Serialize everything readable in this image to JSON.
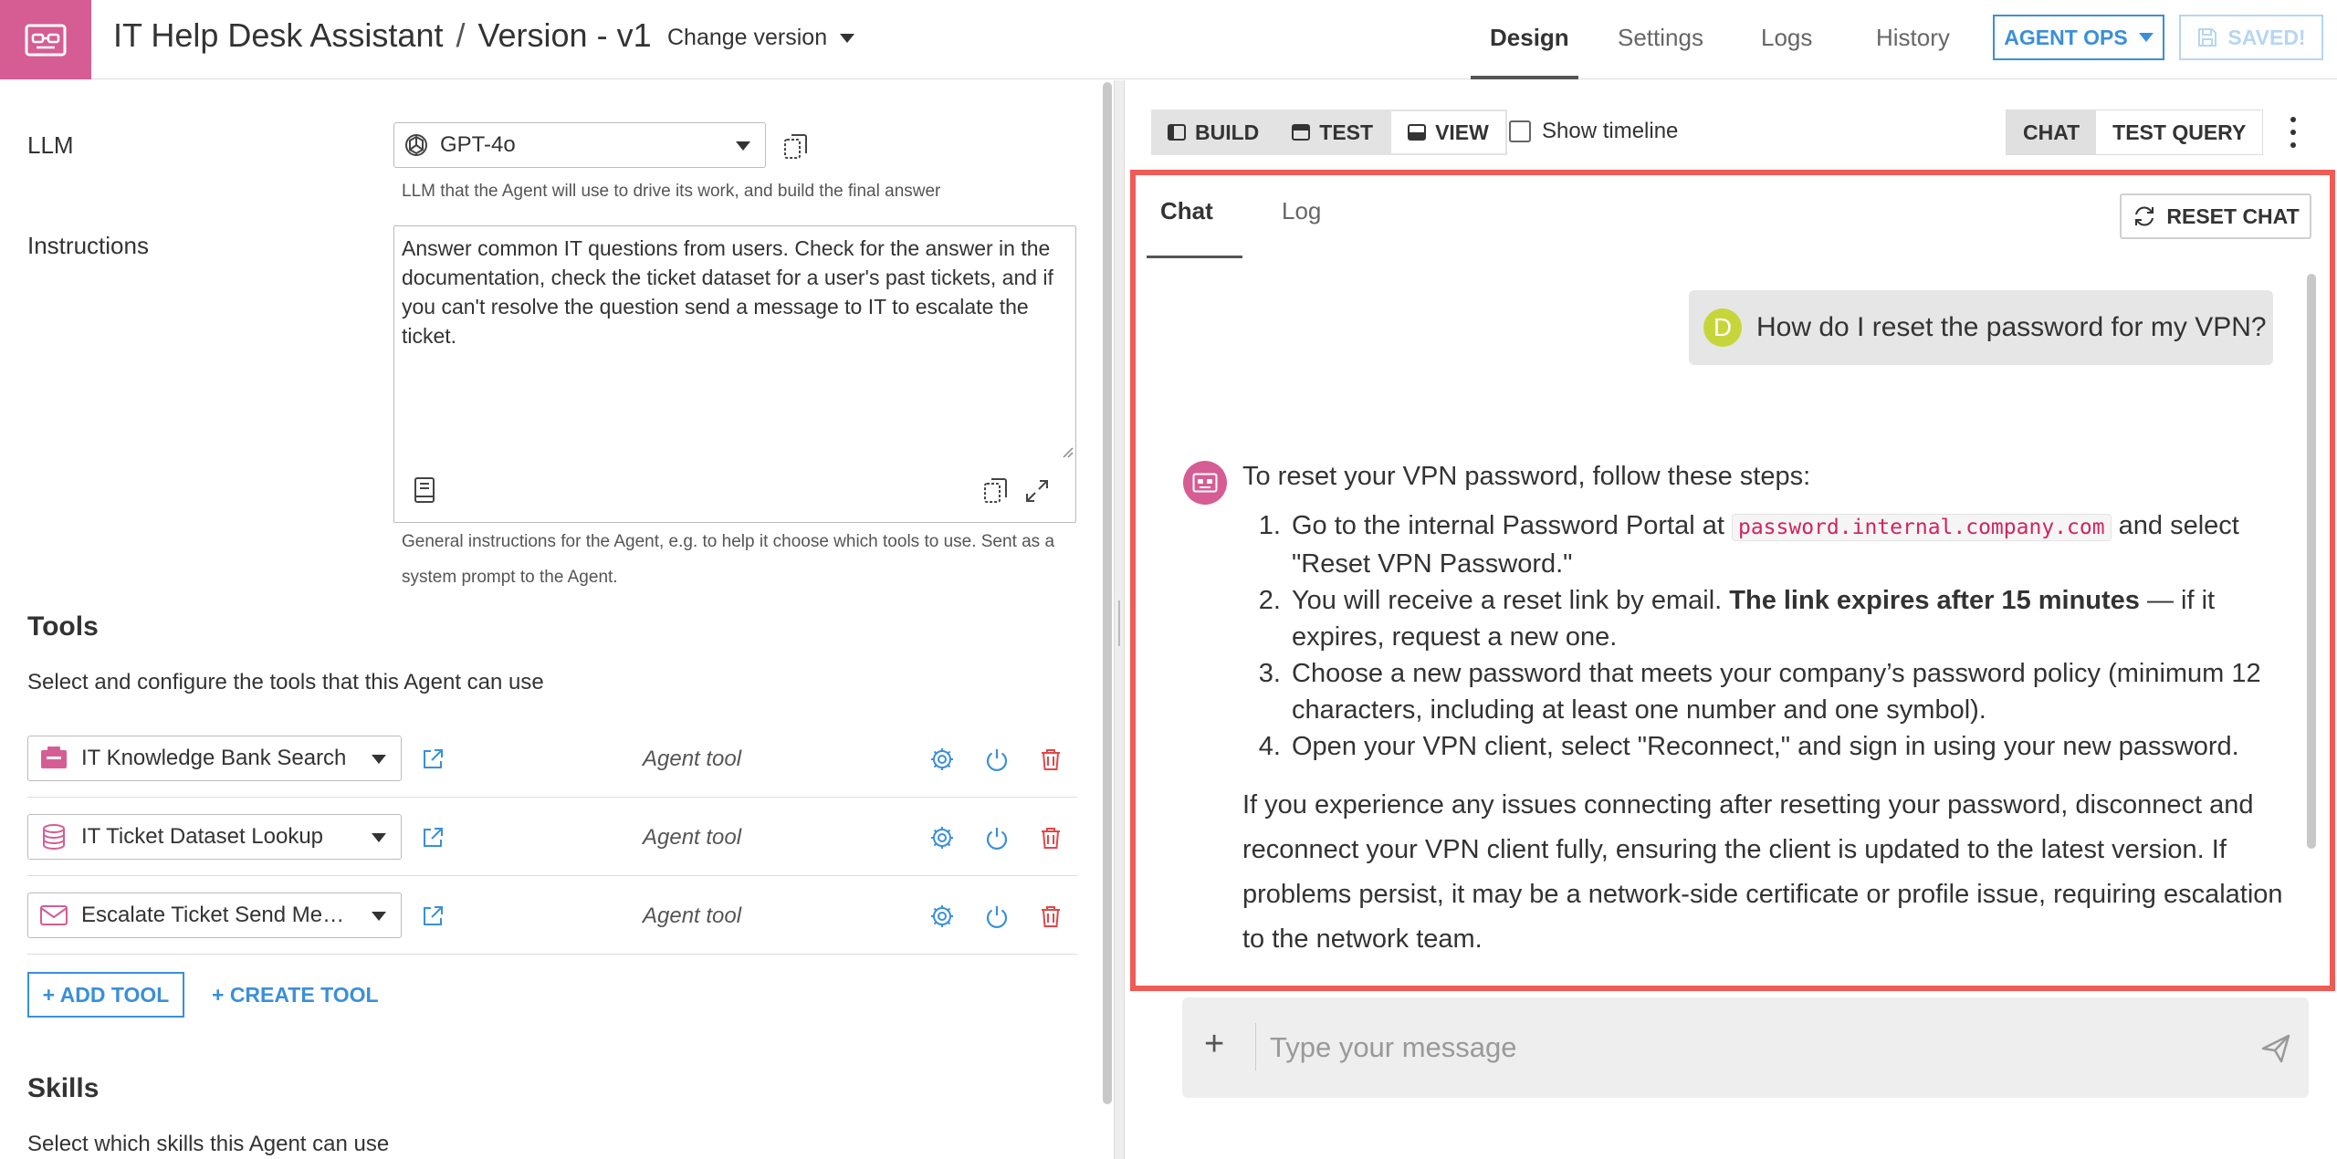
{
  "header": {
    "app_name": "IT Help Desk Assistant",
    "separator": "/",
    "version": "Version - v1",
    "change_version": "Change version",
    "tabs": [
      {
        "label": "Design",
        "active": true
      },
      {
        "label": "Settings",
        "active": false
      },
      {
        "label": "Logs",
        "active": false
      },
      {
        "label": "History",
        "active": false
      }
    ],
    "agent_ops": "AGENT OPS",
    "saved": "SAVED!",
    "brand_color": "#d55d94",
    "accent_color": "#3a8fd9"
  },
  "config": {
    "llm_label": "LLM",
    "llm_value": "GPT-4o",
    "llm_help": "LLM that the Agent will use to drive its work, and build the final answer",
    "instructions_label": "Instructions",
    "instructions_value": "Answer common IT questions from users. Check for the answer in the documentation, check the ticket dataset for a user's past tickets, and if you can't resolve the question send a message to IT to escalate the ticket.",
    "instructions_help_1": "General instructions for the Agent, e.g. to help it choose which tools to use. Sent as a",
    "instructions_help_2": "system prompt to the Agent."
  },
  "tools": {
    "title": "Tools",
    "subtitle": "Select and configure the tools that this Agent can use",
    "items": [
      {
        "name": "IT Knowledge Bank Search",
        "type": "Agent tool",
        "icon": "knowledge-bank-icon"
      },
      {
        "name": "IT Ticket Dataset Lookup",
        "type": "Agent tool",
        "icon": "dataset-icon"
      },
      {
        "name": "Escalate Ticket Send Message",
        "type": "Agent tool",
        "icon": "envelope-icon"
      }
    ],
    "add_tool": "+ ADD TOOL",
    "create_tool": "+ CREATE TOOL"
  },
  "skills": {
    "title": "Skills",
    "subtitle": "Select which skills this Agent can use"
  },
  "right": {
    "modes": [
      {
        "label": "BUILD",
        "active": false
      },
      {
        "label": "TEST",
        "active": false
      },
      {
        "label": "VIEW",
        "active": true
      }
    ],
    "show_timeline": "Show timeline",
    "chat_switch": [
      {
        "label": "CHAT",
        "active": true
      },
      {
        "label": "TEST QUERY",
        "active": false
      }
    ]
  },
  "chat": {
    "tabs": [
      {
        "label": "Chat",
        "active": true
      },
      {
        "label": "Log",
        "active": false
      }
    ],
    "reset": "RESET CHAT",
    "user_initial": "D",
    "user_message": "How do I reset the password for my VPN?",
    "bot_intro": "To reset your VPN password, follow these steps:",
    "step1_pre": "Go to the internal Password Portal at",
    "step1_code": "password.internal.company.com",
    "step1_post": "and select \"Reset VPN Password.\"",
    "step2_pre": "You will receive a reset link by email.",
    "step2_bold": "The link expires after 15 minutes",
    "step2_post": "— if it expires, request a new one.",
    "step3": "Choose a new password that meets your company’s password policy (minimum 12 characters, including at least one number and one symbol).",
    "step4": "Open your VPN client, select \"Reconnect,\" and sign in using your new password.",
    "bot_followup": "If you experience any issues connecting after resetting your password, disconnect and reconnect your VPN client fully, ensuring the client is updated to the latest version. If problems persist, it may be a network-side certificate or profile issue, requiring escalation to the network team.",
    "input_placeholder": "Type your message",
    "highlight_color": "#ef5b55"
  }
}
